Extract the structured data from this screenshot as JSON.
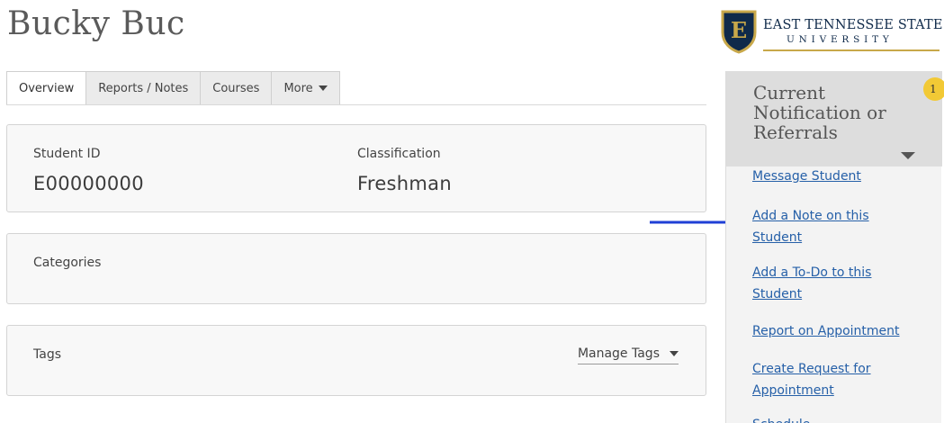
{
  "student": {
    "name": "Bucky Buc"
  },
  "logo": {
    "line1": "EAST TENNESSEE STATE",
    "line2": "UNIVERSITY",
    "shield_letter": "E"
  },
  "tabs": [
    {
      "label": "Overview",
      "active": true
    },
    {
      "label": "Reports / Notes",
      "active": false
    },
    {
      "label": "Courses",
      "active": false
    },
    {
      "label": "More",
      "active": false
    }
  ],
  "info": {
    "student_id_label": "Student ID",
    "student_id_value": "E00000000",
    "classification_label": "Classification",
    "classification_value": "Freshman"
  },
  "categories": {
    "title": "Categories"
  },
  "tags": {
    "title": "Tags",
    "manage_label": "Manage Tags"
  },
  "panel": {
    "title": "Current Notification or Referrals",
    "badge_count": "1",
    "links": [
      "Message Student",
      "Add a Note on this Student",
      "Add a To-Do to this Student",
      "Report on Appointment",
      "Create Request for Appointment",
      "Schedule"
    ]
  },
  "colors": {
    "link": "#2660a8",
    "badge": "#f2c935",
    "arrow": "#1f3fd6",
    "logo_navy": "#0f2a4a",
    "logo_gold": "#c8a84a"
  }
}
